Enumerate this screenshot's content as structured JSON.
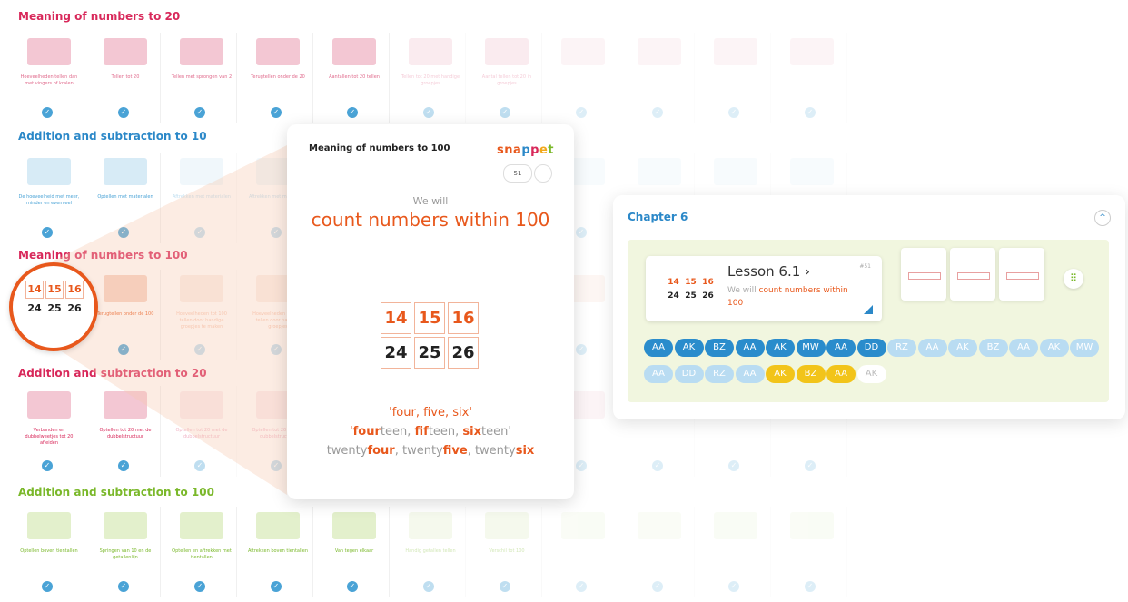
{
  "sections": [
    {
      "title": "Meaning of numbers to 20",
      "color": "#d8285a"
    },
    {
      "title": "Addition and subtraction to 10",
      "color": "#2b88c8"
    },
    {
      "title": "Meaning of numbers to 100",
      "color": "#d8285a"
    },
    {
      "title": "Addition and subtraction to 20",
      "color": "#d8285a"
    },
    {
      "title": "Addition and subtraction to 100",
      "color": "#7ab82a"
    }
  ],
  "tiles": {
    "row1": [
      "Hoeveelheden tellen dan met vingers of kralen",
      "Tellen tot 20",
      "Tellen met sprongen van 2",
      "Terugtellen onder de 20",
      "Aantallen tot 20 tellen",
      "Tellen tot 20 met handige groepjes",
      "Aantal tellen tot 20 in groepjes"
    ],
    "row2": [
      "De hoeveelheid met meer, minder en evenveel",
      "Optellen met materialen",
      "Aftrekken met materialen",
      "Aftrekken met materialen"
    ],
    "row3": [
      "Terugtellen onder de 100",
      "Hoeveelheden tot 100 tellen door handige groepjes te maken",
      "Hoeveelheden tot 100 tellen door handige groepjes"
    ],
    "row4": [
      "Verbanden en dubbelweetjes tot 20 afleiden",
      "Optellen tot 20 met de dubbelstructuur",
      "Optellen tot 20 met de dubbelstructuur",
      "Optellen tot 20 met de dubbelstructuur"
    ],
    "row5": [
      "Optellen boven tientallen",
      "Springen van 10 en de getallenlijn",
      "Optellen en aftrekken met tientallen",
      "Aftrekken boven tientallen",
      "Van tegen elkaar",
      "Handig getallen tellen",
      "Verschil tot 100"
    ]
  },
  "zoom": {
    "top": [
      "14",
      "15",
      "16"
    ],
    "bottom": [
      "24",
      "25",
      "26"
    ]
  },
  "card": {
    "title": "Meaning of numbers to 100",
    "brand": [
      "s",
      "n",
      "a",
      "p",
      "p",
      "e",
      "t"
    ],
    "brand_colors": [
      "#e8581c",
      "#e8581c",
      "#e8581c",
      "#2b88c8",
      "#d8285a",
      "#f2a81a",
      "#7ab82a"
    ],
    "number": "51",
    "we_will": "We will",
    "goal": "count numbers within 100",
    "top": [
      "14",
      "15",
      "16"
    ],
    "bottom": [
      "24",
      "25",
      "26"
    ],
    "line1": [
      "'",
      "four",
      ", ",
      "five",
      ", ",
      "six",
      "'"
    ],
    "line2": [
      "'",
      "four",
      "teen, ",
      "fif",
      "teen, ",
      "six",
      "teen'"
    ],
    "line3": [
      "twenty",
      "four",
      ", twenty",
      "five",
      ", twenty",
      "six"
    ]
  },
  "chapter": {
    "title": "Chapter 6",
    "collapse_icon": "^",
    "lesson_name": "Lesson 6.1 ›",
    "lesson_num": "#51",
    "goal_prefix": "We will ",
    "goal_highlight": "count numbers within 100",
    "mini_top": [
      "14",
      "15",
      "16"
    ],
    "mini_bottom": [
      "24",
      "25",
      "26"
    ],
    "grid_icon": "⠿",
    "chips": [
      {
        "t": "AA",
        "s": "dark"
      },
      {
        "t": "AK",
        "s": "dark"
      },
      {
        "t": "BZ",
        "s": "dark"
      },
      {
        "t": "AA",
        "s": "dark"
      },
      {
        "t": "AK",
        "s": "dark"
      },
      {
        "t": "MW",
        "s": "dark"
      },
      {
        "t": "AA",
        "s": "dark"
      },
      {
        "t": "DD",
        "s": "dark"
      },
      {
        "t": "RZ",
        "s": "light"
      },
      {
        "t": "AA",
        "s": "light"
      },
      {
        "t": "AK",
        "s": "light"
      },
      {
        "t": "BZ",
        "s": "light"
      },
      {
        "t": "AA",
        "s": "light"
      },
      {
        "t": "AK",
        "s": "light"
      },
      {
        "t": "MW",
        "s": "light"
      },
      {
        "t": "AA",
        "s": "light"
      },
      {
        "t": "DD",
        "s": "light"
      },
      {
        "t": "RZ",
        "s": "light"
      },
      {
        "t": "AA",
        "s": "light"
      },
      {
        "t": "AK",
        "s": "yellow"
      },
      {
        "t": "BZ",
        "s": "yellow"
      },
      {
        "t": "AA",
        "s": "yellow"
      },
      {
        "t": "AK",
        "s": "white"
      }
    ]
  }
}
